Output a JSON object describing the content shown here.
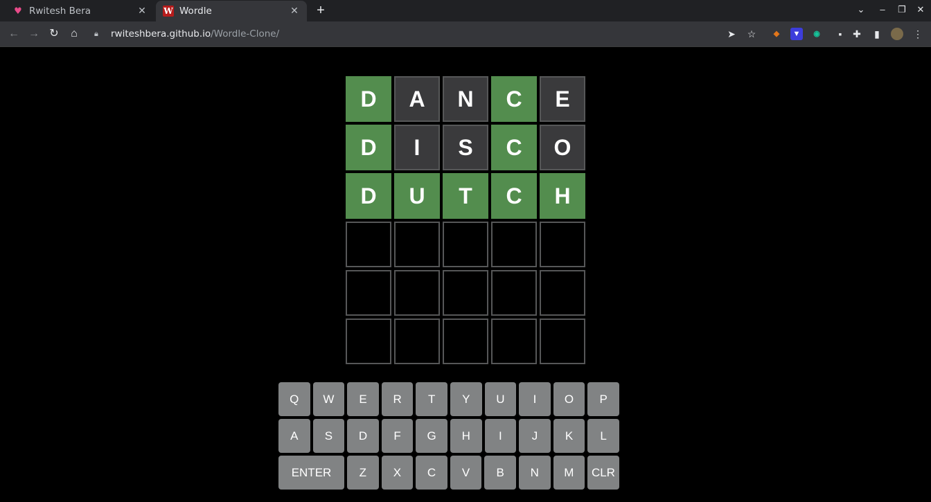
{
  "browser": {
    "tabs": [
      {
        "title": "Rwitesh Bera",
        "icon": "heart-favicon",
        "active": false
      },
      {
        "title": "Wordle",
        "icon": "w-favicon",
        "active": true
      }
    ],
    "url_host": "rwiteshbera.github.io",
    "url_path": "/Wordle-Clone/"
  },
  "board": {
    "rows": [
      [
        {
          "l": "D",
          "s": "correct"
        },
        {
          "l": "A",
          "s": "absent"
        },
        {
          "l": "N",
          "s": "absent"
        },
        {
          "l": "C",
          "s": "correct"
        },
        {
          "l": "E",
          "s": "absent"
        }
      ],
      [
        {
          "l": "D",
          "s": "correct"
        },
        {
          "l": "I",
          "s": "absent"
        },
        {
          "l": "S",
          "s": "absent"
        },
        {
          "l": "C",
          "s": "correct"
        },
        {
          "l": "O",
          "s": "absent"
        }
      ],
      [
        {
          "l": "D",
          "s": "correct"
        },
        {
          "l": "U",
          "s": "correct"
        },
        {
          "l": "T",
          "s": "correct"
        },
        {
          "l": "C",
          "s": "correct"
        },
        {
          "l": "H",
          "s": "correct"
        }
      ],
      [
        {
          "l": "",
          "s": "empty"
        },
        {
          "l": "",
          "s": "empty"
        },
        {
          "l": "",
          "s": "empty"
        },
        {
          "l": "",
          "s": "empty"
        },
        {
          "l": "",
          "s": "empty"
        }
      ],
      [
        {
          "l": "",
          "s": "empty"
        },
        {
          "l": "",
          "s": "empty"
        },
        {
          "l": "",
          "s": "empty"
        },
        {
          "l": "",
          "s": "empty"
        },
        {
          "l": "",
          "s": "empty"
        }
      ],
      [
        {
          "l": "",
          "s": "empty"
        },
        {
          "l": "",
          "s": "empty"
        },
        {
          "l": "",
          "s": "empty"
        },
        {
          "l": "",
          "s": "empty"
        },
        {
          "l": "",
          "s": "empty"
        }
      ]
    ]
  },
  "keyboard": {
    "rows": [
      [
        "Q",
        "W",
        "E",
        "R",
        "T",
        "Y",
        "U",
        "I",
        "O",
        "P"
      ],
      [
        "A",
        "S",
        "D",
        "F",
        "G",
        "H",
        "I",
        "J",
        "K",
        "L"
      ],
      [
        "ENTER",
        "Z",
        "X",
        "C",
        "V",
        "B",
        "N",
        "M",
        "CLR"
      ]
    ]
  },
  "colors": {
    "correct": "#538d4e",
    "absent": "#3a3a3c",
    "key": "#818384",
    "background": "#000000"
  }
}
